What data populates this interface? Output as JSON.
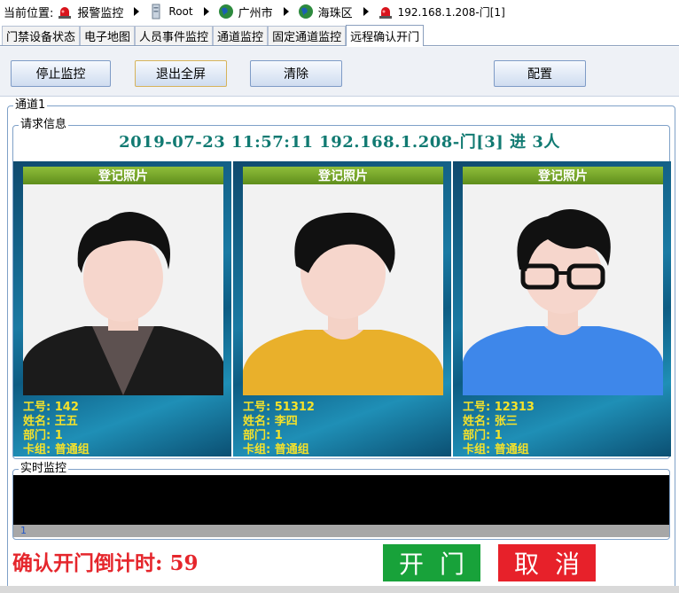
{
  "breadcrumb": {
    "label": "当前位置:",
    "items": [
      {
        "text": "报警监控",
        "icon": "alarm-light-icon"
      },
      {
        "text": "Root",
        "icon": "server-icon"
      },
      {
        "text": "广州市",
        "icon": "globe-icon"
      },
      {
        "text": "海珠区",
        "icon": "globe-icon"
      },
      {
        "text": "192.168.1.208-门[1]",
        "icon": "alarm-light-icon"
      }
    ]
  },
  "tabs": [
    {
      "label": "门禁设备状态",
      "active": false
    },
    {
      "label": "电子地图",
      "active": false
    },
    {
      "label": "人员事件监控",
      "active": false
    },
    {
      "label": "通道监控",
      "active": false
    },
    {
      "label": "固定通道监控",
      "active": false
    },
    {
      "label": "远程确认开门",
      "active": true
    }
  ],
  "toolbar": {
    "stop": "停止监控",
    "exit_fullscreen": "退出全屏",
    "clear": "清除",
    "config": "配置"
  },
  "channel": {
    "title": "通道1",
    "request_group": "请求信息",
    "request_text": "2019-07-23 11:57:11 192.168.1.208-门[3] 进 3人",
    "realtime_group": "实时监控",
    "realtime_status": "1"
  },
  "cards": [
    {
      "header": "登记照片",
      "id": "工号: 142",
      "name": "姓名: 王五",
      "dept": "部门: 1",
      "group": "卡组: 普通组"
    },
    {
      "header": "登记照片",
      "id": "工号: 51312",
      "name": "姓名: 李四",
      "dept": "部门: 1",
      "group": "卡组: 普通组"
    },
    {
      "header": "登记照片",
      "id": "工号: 12313",
      "name": "姓名: 张三",
      "dept": "部门: 1",
      "group": "卡组: 普通组"
    }
  ],
  "countdown": "确认开门倒计时: 59",
  "actions": {
    "open": "开门",
    "cancel": "取消"
  },
  "colors": {
    "accent_teal": "#117a72",
    "warning_red": "#e5262c",
    "open_green": "#18a23a",
    "cancel_red": "#e7212a"
  }
}
